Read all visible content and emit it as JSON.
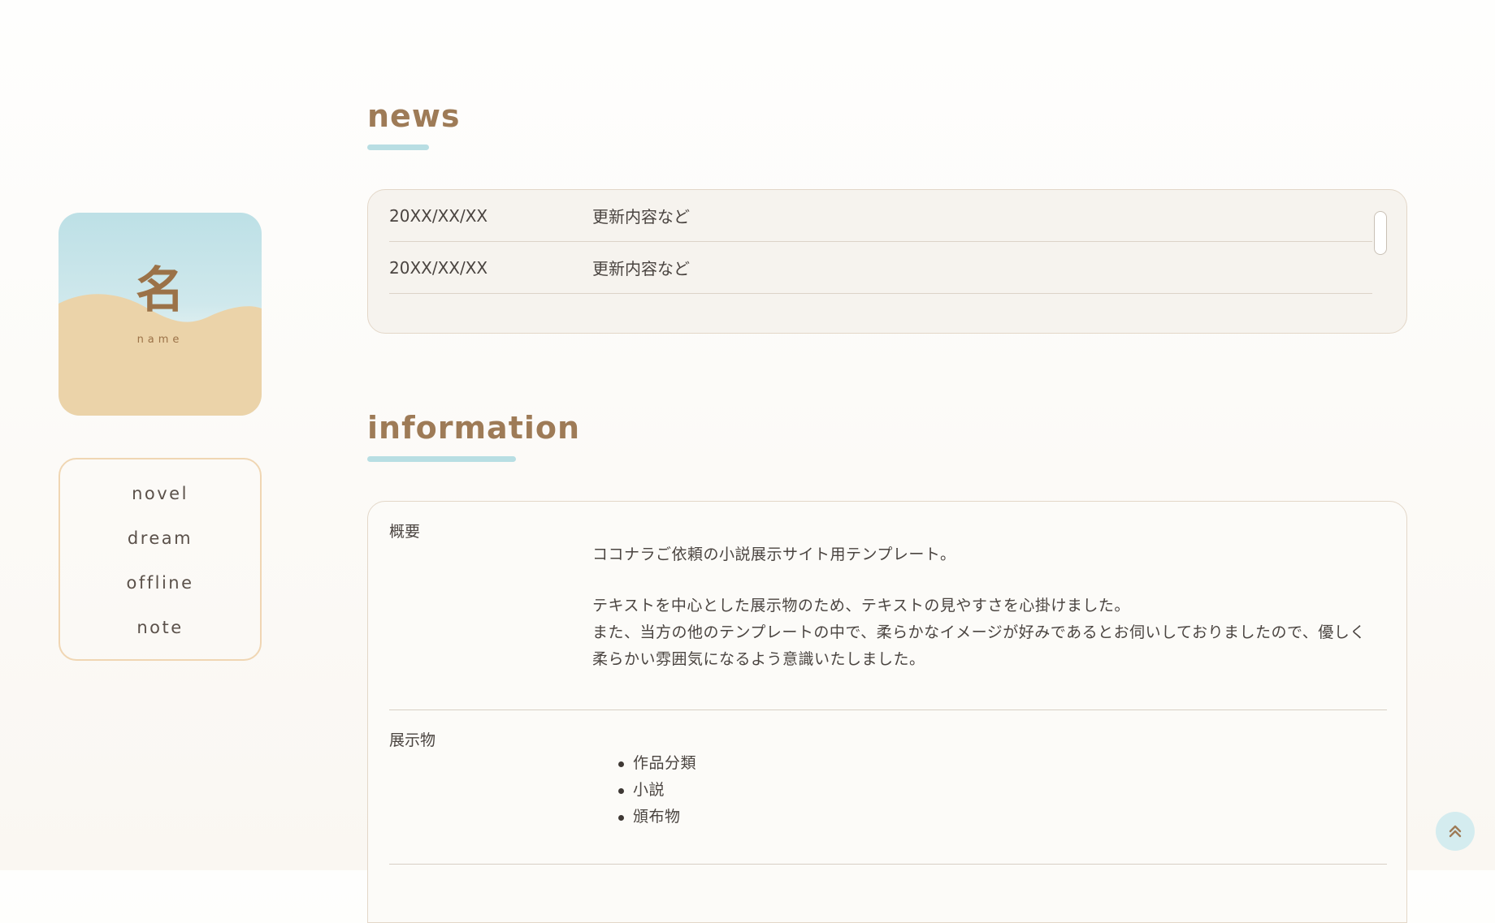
{
  "logo": {
    "char": "名",
    "sub": "name"
  },
  "nav": {
    "items": [
      {
        "label": "novel"
      },
      {
        "label": "dream"
      },
      {
        "label": "offline"
      },
      {
        "label": "note"
      }
    ]
  },
  "news": {
    "title": "news",
    "entries": [
      {
        "date": "20XX/XX/XX",
        "text": "更新内容など"
      },
      {
        "date": "20XX/XX/XX",
        "text": "更新内容など"
      }
    ]
  },
  "information": {
    "title": "information",
    "overview": {
      "label": "概要",
      "line1": "ココナラご依頼の小説展示サイト用テンプレート。",
      "line2": "テキストを中心とした展示物のため、テキストの見やすさを心掛けました。",
      "line3": "また、当方の他のテンプレートの中で、柔らかなイメージが好みであるとお伺いしておりましたので、優しく",
      "line4": "柔らかい雰囲気になるよう意識いたしました。"
    },
    "exhibits": {
      "label": "展示物",
      "items": [
        "作品分類",
        "小説",
        "頒布物"
      ]
    }
  },
  "colors": {
    "accent": "#b8dee3",
    "title": "#9e7b57",
    "sand": "#ebd3a9",
    "border": "#f0d6b3"
  },
  "icons": {
    "scroll_top": "double-chevron-up-icon"
  }
}
